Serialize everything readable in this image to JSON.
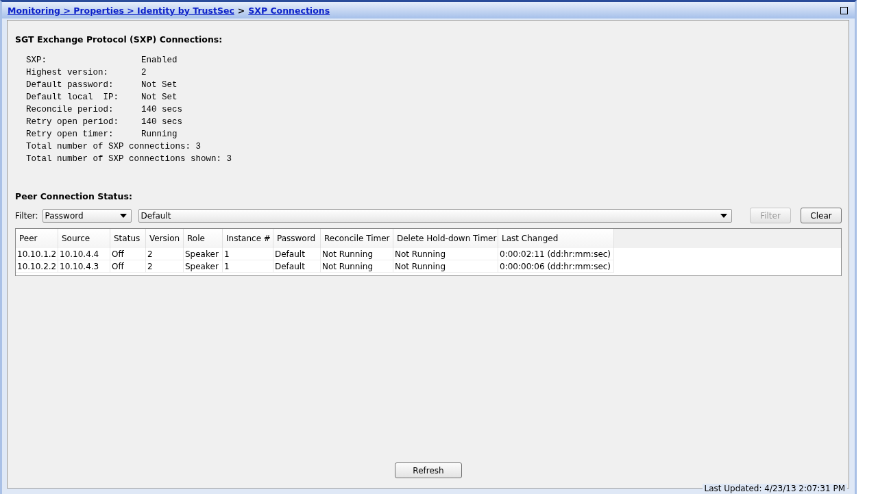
{
  "breadcrumb": {
    "links": [
      "Monitoring > Properties > Identity by TrustSec",
      "SXP Connections"
    ],
    "separator": ">"
  },
  "title": "SGT Exchange Protocol (SXP) Connections:",
  "settings": [
    {
      "kind": "pair",
      "label": "SXP:",
      "value": "Enabled"
    },
    {
      "kind": "pair",
      "label": "Highest version:",
      "value": "2"
    },
    {
      "kind": "pair",
      "label": "Default password:",
      "value": "Not Set"
    },
    {
      "kind": "pair",
      "label": "Default local  IP:",
      "value": "Not Set"
    },
    {
      "kind": "pair",
      "label": "Reconcile period:",
      "value": "140 secs"
    },
    {
      "kind": "pair",
      "label": "Retry open period:",
      "value": "140 secs"
    },
    {
      "kind": "pair",
      "label": "Retry open timer:",
      "value": "Running"
    },
    {
      "kind": "line",
      "label": "Total number of SXP connections: 3"
    },
    {
      "kind": "line",
      "label": "Total number of SXP connections shown: 3"
    }
  ],
  "peer_section": {
    "title": "Peer Connection Status:",
    "filter_label": "Filter:",
    "filter_field": "Password",
    "filter_value": "Default",
    "buttons": [
      {
        "label": "Filter",
        "disabled": true
      },
      {
        "label": "Clear",
        "disabled": false
      }
    ]
  },
  "table": {
    "columns": [
      "Peer",
      "Source",
      "Status",
      "Version",
      "Role",
      "Instance #",
      "Password",
      "Reconcile Timer",
      "Delete Hold-down Timer",
      "Last Changed"
    ],
    "rows": [
      [
        "10.10.1.2",
        "10.10.4.4",
        "Off",
        "2",
        "Speaker",
        "1",
        "Default",
        "Not Running",
        "Not Running",
        "0:00:02:11 (dd:hr:mm:sec)"
      ],
      [
        "10.10.2.2",
        "10.10.4.3",
        "Off",
        "2",
        "Speaker",
        "1",
        "Default",
        "Not Running",
        "Not Running",
        "0:00:00:06 (dd:hr:mm:sec)"
      ]
    ]
  },
  "refresh_button": "Refresh",
  "last_updated": "Last Updated: 4/23/13 2:07:31 PM"
}
